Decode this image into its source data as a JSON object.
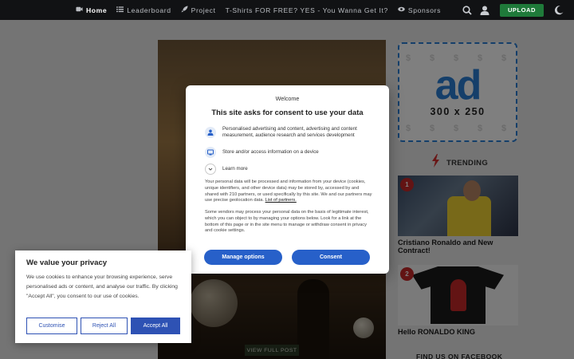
{
  "nav": {
    "items": [
      {
        "label": "Home",
        "icon": "video-icon",
        "active": true
      },
      {
        "label": "Leaderboard",
        "icon": "list-icon",
        "active": false
      },
      {
        "label": "Project",
        "icon": "rocket-icon",
        "active": false
      },
      {
        "label": "T-Shirts FOR FREE? YES - You Wanna Get It?",
        "icon": "",
        "active": false
      },
      {
        "label": "Sponsors",
        "icon": "eye-icon",
        "active": false
      }
    ],
    "upload_label": "UPLOAD",
    "accent_color": "#1f7a3a"
  },
  "main": {
    "view_post_label": "VIEW FULL POST"
  },
  "sidebar": {
    "ad": {
      "text": "ad",
      "size": "300 x 250",
      "accent_color": "#2a7fd4"
    },
    "trending_label": "TRENDING",
    "trending_items": [
      {
        "rank": "1",
        "title": "Cristiano Ronaldo and New Contract!"
      },
      {
        "rank": "2",
        "title": "Hello RONALDO KING"
      }
    ],
    "find_us": "FIND US ON FACEBOOK"
  },
  "consent_modal": {
    "welcome": "Welcome",
    "title": "This site asks for consent to use your data",
    "purposes": [
      {
        "icon": "person-icon",
        "text": "Personalised advertising and content, advertising and content measurement, audience research and services development"
      },
      {
        "icon": "device-icon",
        "text": "Store and/or access information on a device"
      }
    ],
    "learn_more": "Learn more",
    "body1": "Your personal data will be processed and information from your device (cookies, unique identifiers, and other device data) may be stored by, accessed by and shared with 210 partners, or used specifically by this site. We and our partners may use precise geolocation data.",
    "partners_link": "List of partners.",
    "body2": "Some vendors may process your personal data on the basis of legitimate interest, which you can object to by managing your options below. Look for a link at the bottom of this page or in the site menu to manage or withdraw consent in privacy and cookie settings.",
    "manage_label": "Manage options",
    "consent_label": "Consent",
    "button_color": "#2760c9"
  },
  "privacy_banner": {
    "title": "We value your privacy",
    "text": "We use cookies to enhance your browsing experience, serve personalised ads or content, and analyse our traffic. By clicking \"Accept All\", you consent to our use of cookies.",
    "customise_label": "Customise",
    "reject_label": "Reject All",
    "accept_label": "Accept All",
    "button_color": "#2e52b4"
  }
}
